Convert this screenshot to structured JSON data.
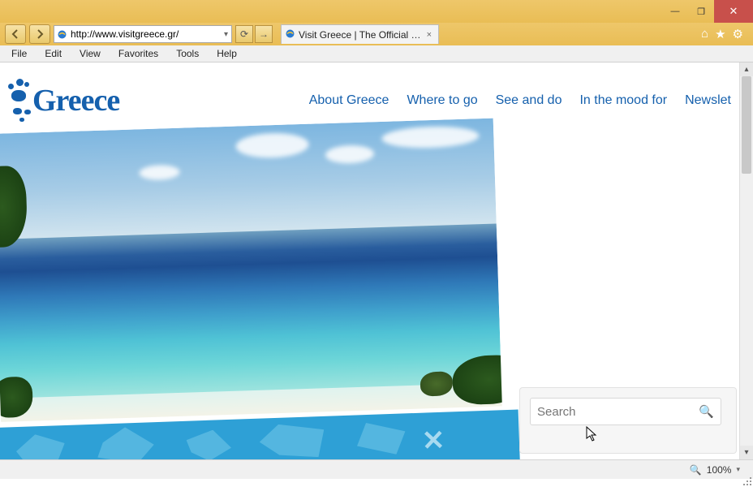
{
  "window": {
    "minimize": "—",
    "maximize": "❐",
    "close": "✕"
  },
  "address": {
    "url": "http://www.visitgreece.gr/",
    "refresh_glyph": "⟳",
    "stop_glyph": "✕",
    "go_glyph": "→",
    "dropdown_glyph": "▾"
  },
  "tab": {
    "title": "Visit Greece | The Official w...",
    "close_glyph": "×"
  },
  "toolbar_icons": {
    "home": "⌂",
    "favorites": "★",
    "tools": "⚙"
  },
  "menu": {
    "items": [
      "File",
      "Edit",
      "View",
      "Favorites",
      "Tools",
      "Help"
    ]
  },
  "page": {
    "logo_text": "Greece",
    "nav": [
      "About Greece",
      "Where to go",
      "See and do",
      "In the mood for",
      "Newslet"
    ]
  },
  "search": {
    "placeholder": "Search",
    "icon_glyph": "🔍"
  },
  "status": {
    "zoom_icon": "🔍",
    "zoom": "100%",
    "dropdown": "▾"
  },
  "colors": {
    "titlebar": "#e9bd55",
    "link": "#1560ad",
    "close": "#c8504b"
  }
}
